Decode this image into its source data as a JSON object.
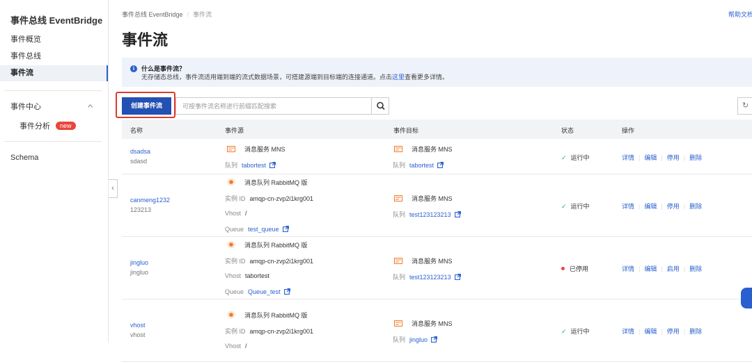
{
  "sidebar": {
    "title": "事件总线 EventBridge",
    "items": [
      "事件概览",
      "事件总线",
      "事件流"
    ],
    "event_center": "事件中心",
    "event_analysis": "事件分析",
    "new_badge": "new",
    "schema": "Schema"
  },
  "breadcrumb": {
    "root": "事件总线 EventBridge",
    "current": "事件流"
  },
  "help": "帮助文档",
  "page_title": "事件流",
  "info": {
    "title": "什么是事件流？",
    "text_before": "无存储态总线，事件流适用端到端的流式数据场景，可搭建源端到目标端的连接通道。点击",
    "link": "这里",
    "text_after": "查看更多详情。"
  },
  "toolbar": {
    "create_label": "创建事件流",
    "search_placeholder": "可按事件流名称进行前缀匹配搜索"
  },
  "table": {
    "headers": [
      "名称",
      "事件源",
      "事件目标",
      "状态",
      "操作"
    ],
    "rows": [
      {
        "name": "dsadsa",
        "desc": "sdasd",
        "source": {
          "type": "mns",
          "title": "消息服务 MNS",
          "fields": [
            {
              "label": "队列",
              "value": "tabortest",
              "link": true
            }
          ]
        },
        "target": {
          "title": "消息服务 MNS",
          "fields": [
            {
              "label": "队列",
              "value": "tabortest",
              "link": true
            }
          ]
        },
        "status": "运行中",
        "status_kind": "running",
        "ops": [
          "详情",
          "编辑",
          "停用",
          "删除"
        ]
      },
      {
        "name": "canmeng1232",
        "desc": "123213",
        "source": {
          "type": "rabbitmq",
          "title": "消息队列 RabbitMQ 版",
          "fields": [
            {
              "label": "实例 ID",
              "value": "amqp-cn-zvp2i1krg001",
              "link": false
            },
            {
              "label": "Vhost",
              "value": "/",
              "link": false
            },
            {
              "label": "Queue",
              "value": "test_queue",
              "link": true
            }
          ]
        },
        "target": {
          "title": "消息服务 MNS",
          "fields": [
            {
              "label": "队列",
              "value": "test123123213",
              "link": true
            }
          ]
        },
        "status": "运行中",
        "status_kind": "running",
        "ops": [
          "详情",
          "编辑",
          "停用",
          "删除"
        ]
      },
      {
        "name": "jingluo",
        "desc": "jingluo",
        "source": {
          "type": "rabbitmq",
          "title": "消息队列 RabbitMQ 版",
          "fields": [
            {
              "label": "实例 ID",
              "value": "amqp-cn-zvp2i1krg001",
              "link": false
            },
            {
              "label": "Vhost",
              "value": "tabortest",
              "link": false
            },
            {
              "label": "Queue",
              "value": "Queue_test",
              "link": true
            }
          ]
        },
        "target": {
          "title": "消息服务 MNS",
          "fields": [
            {
              "label": "队列",
              "value": "test123123213",
              "link": true
            }
          ]
        },
        "status": "已停用",
        "status_kind": "stopped",
        "ops": [
          "详情",
          "编辑",
          "启用",
          "删除"
        ]
      },
      {
        "name": "vhost",
        "desc": "vhost",
        "source": {
          "type": "rabbitmq",
          "title": "消息队列 RabbitMQ 版",
          "fields": [
            {
              "label": "实例 ID",
              "value": "amqp-cn-zvp2i1krg001",
              "link": false
            },
            {
              "label": "Vhost",
              "value": "/",
              "link": false
            }
          ]
        },
        "target": {
          "title": "消息服务 MNS",
          "fields": [
            {
              "label": "队列",
              "value": "jingluo",
              "link": true
            }
          ]
        },
        "status": "运行中",
        "status_kind": "running",
        "ops": [
          "详情",
          "编辑",
          "停用",
          "删除"
        ]
      }
    ]
  }
}
